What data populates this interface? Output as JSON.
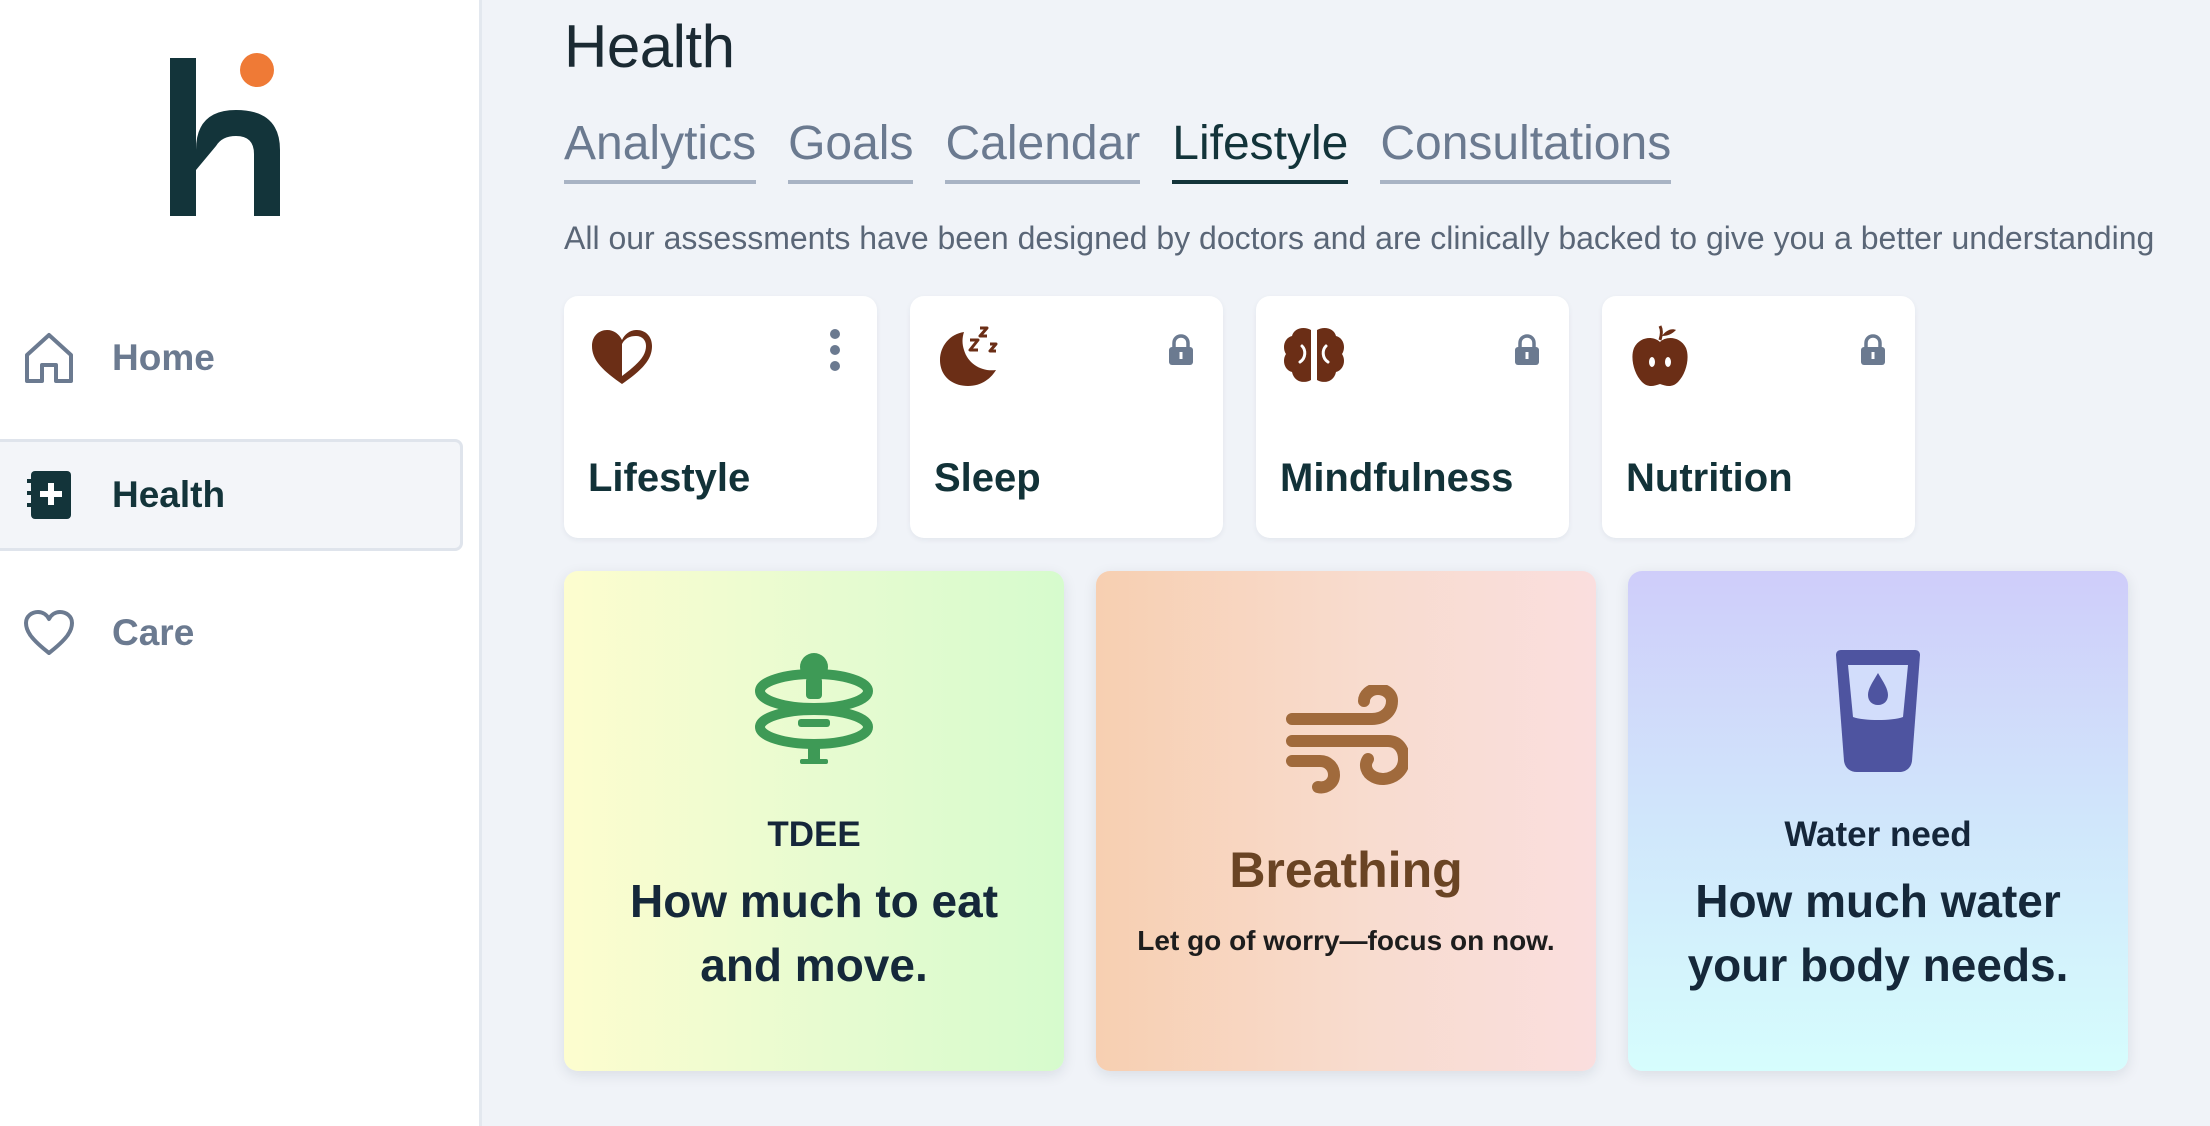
{
  "sidebar": {
    "logo_letter": "h",
    "items": [
      {
        "label": "Home",
        "icon": "home-icon"
      },
      {
        "label": "Health",
        "icon": "health-notebook-icon"
      },
      {
        "label": "Care",
        "icon": "heart-outline-icon"
      }
    ]
  },
  "header": {
    "title": "Health"
  },
  "tabs": [
    {
      "label": "Analytics"
    },
    {
      "label": "Goals"
    },
    {
      "label": "Calendar"
    },
    {
      "label": "Lifestyle",
      "active": true
    },
    {
      "label": "Consultations"
    }
  ],
  "intro_text": "All our assessments have been designed by doctors and are clinically backed to give you a better understanding",
  "categories": [
    {
      "label": "Lifestyle",
      "icon": "heart-half-icon",
      "corner": "more-vertical-icon"
    },
    {
      "label": "Sleep",
      "icon": "moon-zzz-icon",
      "corner": "lock-icon"
    },
    {
      "label": "Mindfulness",
      "icon": "brain-icon",
      "corner": "lock-icon"
    },
    {
      "label": "Nutrition",
      "icon": "apple-icon",
      "corner": "lock-icon"
    }
  ],
  "assessments": {
    "tdee": {
      "subtitle": "TDEE",
      "heading_line1": "How much to eat",
      "heading_line2": "and move.",
      "icon": "person-rings-icon"
    },
    "breathing": {
      "title": "Breathing",
      "description": "Let go of worry—focus on now.",
      "icon": "wind-icon"
    },
    "water": {
      "subtitle": "Water need",
      "heading_line1": "How much water",
      "heading_line2": "your body needs.",
      "icon": "water-glass-icon"
    }
  },
  "colors": {
    "brand_dark": "#13343a",
    "brand_accent": "#ef7a36",
    "icon_brown": "#6b2e16",
    "tdee_green": "#3e9a56",
    "breath_brown": "#a06a3c",
    "water_indigo": "#4e54a0"
  }
}
